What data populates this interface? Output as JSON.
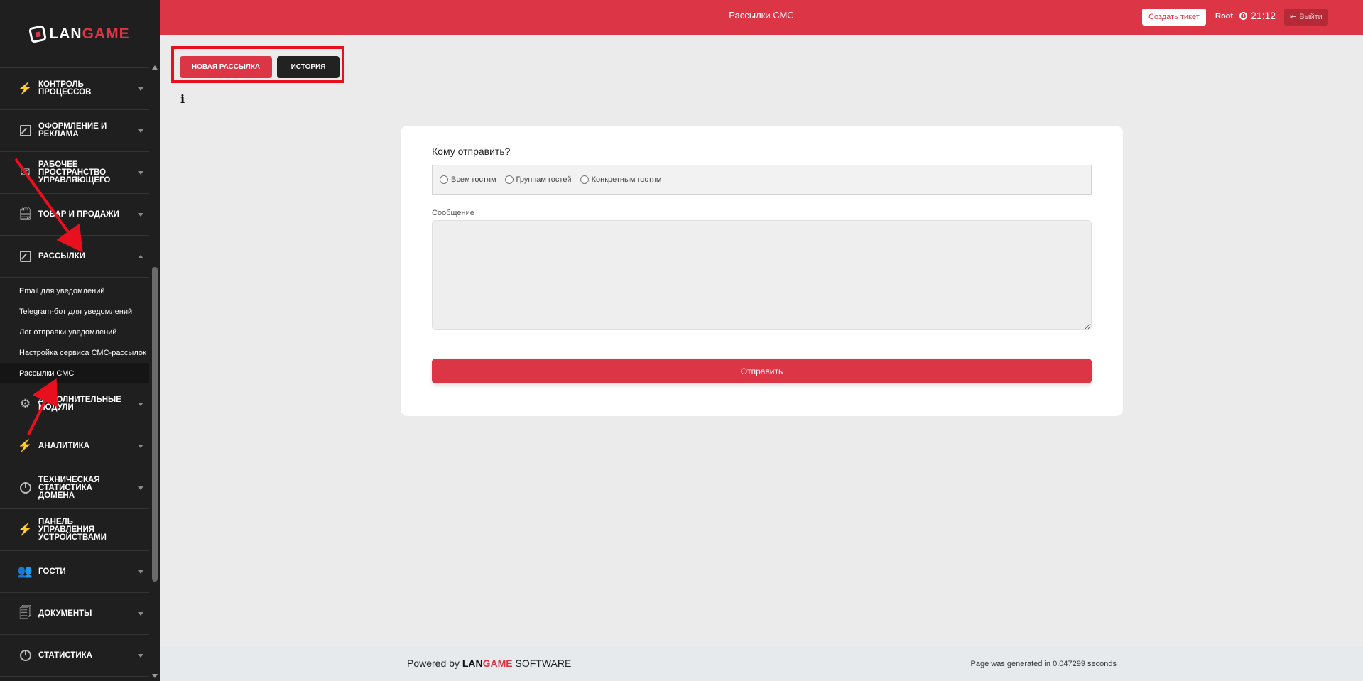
{
  "brand": {
    "lan": "LAN",
    "game": "GAME"
  },
  "sidebar": {
    "items": [
      {
        "label": "Контроль процессов",
        "icon": "lightning-icon"
      },
      {
        "label": "Оформление и реклама",
        "icon": "edit-square-icon"
      },
      {
        "label": "Рабочее пространство управляющего",
        "icon": "envelope-icon"
      },
      {
        "label": "Товар и продажи",
        "icon": "note-icon"
      },
      {
        "label": "Рассылки",
        "icon": "edit-square-icon"
      },
      {
        "label": "Дополнительные модули",
        "icon": "gear-icon"
      },
      {
        "label": "Аналитика",
        "icon": "lightning-icon"
      },
      {
        "label": "Техническая статистика домена",
        "icon": "pie-chart-icon"
      },
      {
        "label": "Панель управления устройствами",
        "icon": "lightning-icon"
      },
      {
        "label": "Гости",
        "icon": "users-icon"
      },
      {
        "label": "Документы",
        "icon": "document-icon"
      },
      {
        "label": "Статистика",
        "icon": "pie-chart-icon"
      }
    ],
    "submenu": [
      "Email для уведомлений",
      "Telegram-бот для уведомлений",
      "Лог отправки уведомлений",
      "Настройка сервиса СМС-рассылок",
      "Рассылки СМС"
    ]
  },
  "topbar": {
    "title": "Рассылки СМС",
    "ticket": "Создать тикет",
    "user": "Root",
    "time": "21:12",
    "logout": "Выйти"
  },
  "tabs": {
    "new": "Новая рассылка",
    "history": "История"
  },
  "form": {
    "question": "Кому отправить?",
    "radios": [
      "Всем гостям",
      "Группам гостей",
      "Конкретным гостям"
    ],
    "message_label": "Сообщение",
    "message_value": "",
    "send": "Отправить"
  },
  "footer": {
    "powered_prefix": "Powered by",
    "powered_lan": "LAN",
    "powered_game": "GAME",
    "powered_suffix": "SOFTWARE",
    "generated": "Page was generated in 0.047299 seconds"
  },
  "colors": {
    "accent": "#dc3545",
    "sidebar": "#1f1f1f",
    "annotation": "#e8101e"
  }
}
